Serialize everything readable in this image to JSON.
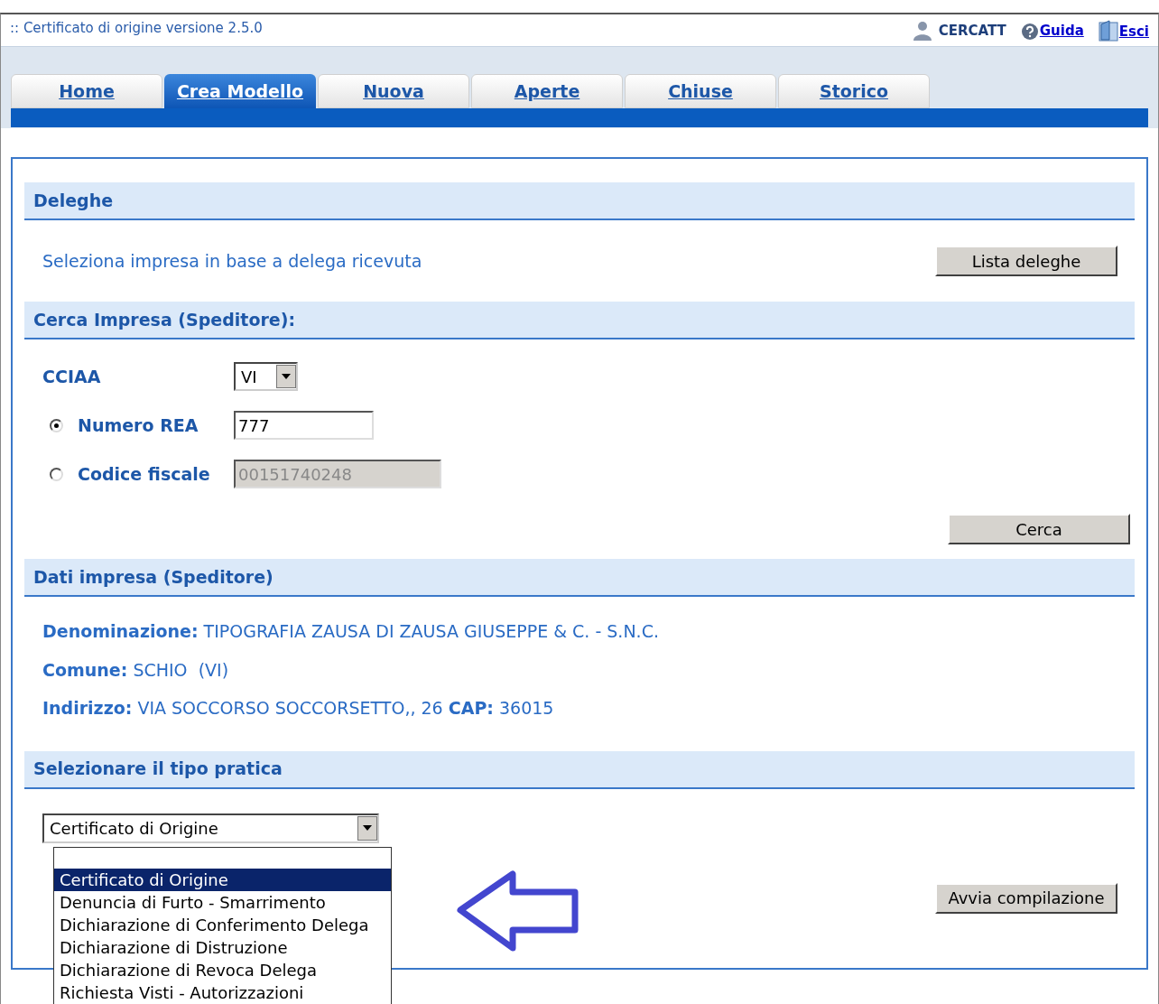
{
  "app_title": ":: Certificato di origine versione 2.5.0",
  "user": {
    "name": "CERCATT"
  },
  "header_links": [
    {
      "label": "Guida",
      "kind": "help"
    },
    {
      "label": "Esci",
      "kind": "exit"
    }
  ],
  "tabs": [
    {
      "label": "Home",
      "selected": false
    },
    {
      "label": "Crea Modello",
      "selected": true
    },
    {
      "label": "Nuova",
      "selected": false
    },
    {
      "label": "Aperte",
      "selected": false
    },
    {
      "label": "Chiuse",
      "selected": false
    },
    {
      "label": "Storico",
      "selected": false
    }
  ],
  "deleghe": {
    "title": "Deleghe",
    "text": "Seleziona impresa in base a delega ricevuta",
    "button": "Lista deleghe"
  },
  "search": {
    "title": "Cerca Impresa (Speditore):",
    "cciaa_label": "CCIAA",
    "cciaa_value": "VI",
    "options": [
      {
        "label": "Numero REA",
        "selected": true,
        "value": "777",
        "disabled": false
      },
      {
        "label": "Codice fiscale",
        "selected": false,
        "value": "00151740248",
        "disabled": true
      }
    ],
    "button": "Cerca"
  },
  "company": {
    "title": "Dati impresa (Speditore)",
    "lines": [
      "**Denominazione:** TIPOGRAFIA ZAUSA DI ZAUSA GIUSEPPE & C. - S.N.C.",
      "**Comune:** SCHIO  (VI)",
      "**Indirizzo:** VIA SOCCORSO SOCCORSETTO,, 26 **CAP:** 36015"
    ]
  },
  "practice": {
    "title": "Selezionare il tipo pratica",
    "value": "Certificato di Origine",
    "expanded": true,
    "options": [
      {
        "label": "Certificato di Origine",
        "selected": true
      },
      {
        "label": "Denuncia di Furto - Smarrimento",
        "selected": false
      },
      {
        "label": "Dichiarazione di Conferimento Delega",
        "selected": false
      },
      {
        "label": "Dichiarazione di Distruzione",
        "selected": false
      },
      {
        "label": "Dichiarazione di Revoca Delega",
        "selected": false
      },
      {
        "label": "Richiesta Visti - Autorizzazioni",
        "selected": false
      }
    ],
    "button": "Avvia compilazione"
  }
}
